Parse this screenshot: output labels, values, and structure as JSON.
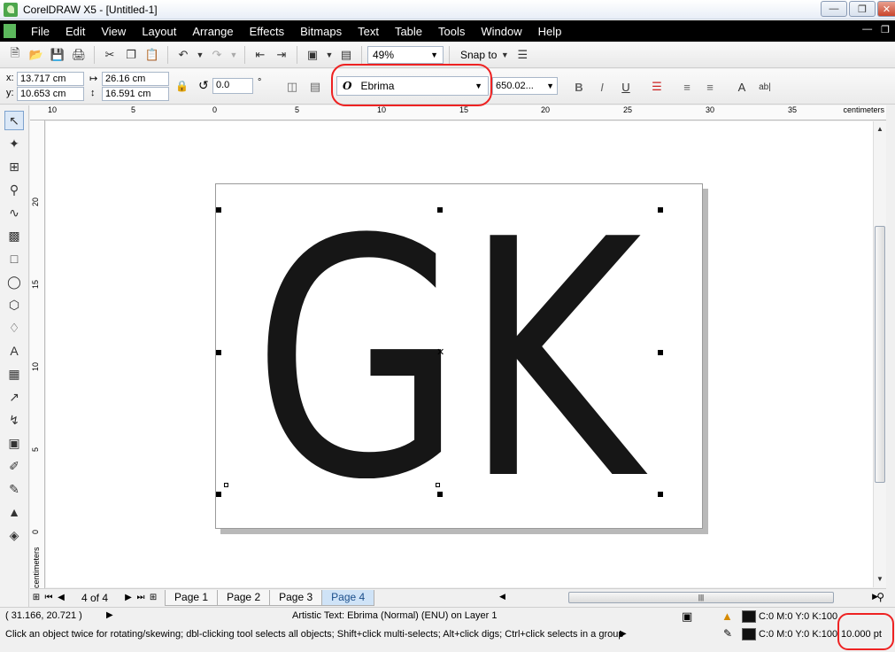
{
  "window": {
    "title": "CorelDRAW X5 - [Untitled-1]"
  },
  "menu": [
    "File",
    "Edit",
    "View",
    "Layout",
    "Arrange",
    "Effects",
    "Bitmaps",
    "Text",
    "Table",
    "Tools",
    "Window",
    "Help"
  ],
  "toolbar": {
    "zoom": "49%",
    "snap_label": "Snap to"
  },
  "property_bar": {
    "x_label": "x:",
    "x_value": "13.717 cm",
    "y_label": "y:",
    "y_value": "10.653 cm",
    "w_value": "26.16 cm",
    "h_value": "16.591 cm",
    "angle_value": "0.0",
    "angle_unit": "°",
    "font_name": "Ebrima",
    "font_size": "650.02..."
  },
  "ruler": {
    "h_labels": [
      "10",
      "5",
      "0",
      "5",
      "10",
      "15",
      "20",
      "25",
      "30",
      "35"
    ],
    "v_labels": [
      "20",
      "15",
      "10",
      "5",
      "0"
    ],
    "unit": "centimeters"
  },
  "canvas": {
    "text": "GK",
    "colors": {
      "glyph": "#161616",
      "accent": "#e22222"
    }
  },
  "page_nav": {
    "count": "4 of 4",
    "tabs": [
      "Page 1",
      "Page 2",
      "Page 3",
      "Page 4"
    ],
    "active_tab": "Page 4"
  },
  "status": {
    "coords": "( 31.166, 20.721 )",
    "info": "Artistic Text: Ebrima (Normal) (ENU) on Layer 1",
    "hint": "Click an object twice for rotating/skewing; dbl-clicking tool selects all objects; Shift+click multi-selects; Alt+click digs; Ctrl+click selects in a group",
    "fill_color": "C:0 M:0 Y:0 K:100",
    "outline_color": "C:0 M:0 Y:0 K:100",
    "outline_width": "10.000 pt"
  }
}
